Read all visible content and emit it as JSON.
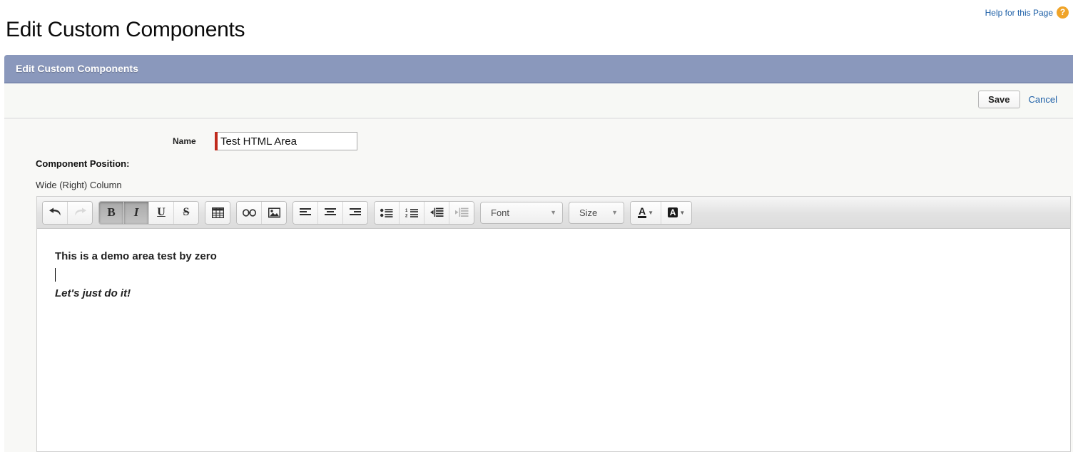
{
  "page": {
    "title": "Edit Custom Components",
    "help_label": "Help for this Page",
    "help_icon": "question-mark-circle-icon"
  },
  "section": {
    "header_title": "Edit Custom Components",
    "actions": {
      "save_label": "Save",
      "cancel_label": "Cancel"
    }
  },
  "form": {
    "name_field": {
      "label": "Name",
      "value": "Test HTML Area",
      "placeholder": "",
      "required": true
    },
    "component_position": {
      "label": "Component Position:",
      "value": "Wide (Right) Column"
    }
  },
  "editor": {
    "toolbar": {
      "undo": {
        "label": "Undo",
        "icon": "undo-arrow-icon",
        "disabled": false
      },
      "redo": {
        "label": "Redo",
        "icon": "redo-arrow-icon",
        "disabled": true
      },
      "bold": {
        "label": "B",
        "icon": "bold-icon",
        "active": true
      },
      "italic": {
        "label": "I",
        "icon": "italic-icon",
        "active": true
      },
      "underline": {
        "label": "U",
        "icon": "underline-icon",
        "active": false
      },
      "strikethrough": {
        "label": "S",
        "icon": "strikethrough-icon",
        "active": false
      },
      "table": {
        "label": "Table",
        "icon": "table-icon"
      },
      "link": {
        "label": "Link",
        "icon": "link-icon"
      },
      "image": {
        "label": "Image",
        "icon": "image-icon"
      },
      "align_left": {
        "label": "Align Left",
        "icon": "align-left-icon"
      },
      "align_center": {
        "label": "Align Center",
        "icon": "align-center-icon"
      },
      "align_right": {
        "label": "Align Right",
        "icon": "align-right-icon"
      },
      "bullet_list": {
        "label": "Bulleted List",
        "icon": "bullet-list-icon"
      },
      "numbered_list": {
        "label": "Numbered List",
        "icon": "numbered-list-icon"
      },
      "indent": {
        "label": "Indent",
        "icon": "indent-icon",
        "disabled": false
      },
      "outdent": {
        "label": "Outdent",
        "icon": "outdent-icon",
        "disabled": true
      },
      "font_select": {
        "label": "Font",
        "caret": "▼"
      },
      "size_select": {
        "label": "Size",
        "caret": "▼"
      },
      "text_color": {
        "label": "A",
        "icon": "text-color-icon",
        "caret": "▼"
      },
      "highlight_color": {
        "label": "A",
        "icon": "highlight-color-icon",
        "caret": "▼"
      }
    },
    "content": {
      "line1": "This is a demo area test by zero",
      "line2": "",
      "line3": "Let's just do it!"
    }
  },
  "colors": {
    "header_bar": "#8a98bc",
    "link": "#1c5ea6",
    "required_marker": "#c02a1c",
    "help_icon": "#f0a429",
    "page_bg": "#f8f8f6"
  }
}
